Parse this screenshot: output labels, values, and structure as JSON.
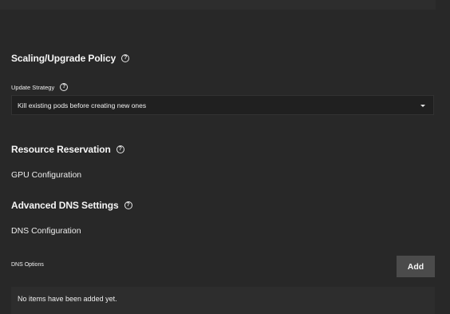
{
  "scaling": {
    "title": "Scaling/Upgrade Policy",
    "update_strategy_label": "Update Strategy",
    "update_strategy_value": "Kill existing pods before creating new ones"
  },
  "resources": {
    "title": "Resource Reservation",
    "gpu_label": "GPU Configuration"
  },
  "dns": {
    "title": "Advanced DNS Settings",
    "config_label": "DNS Configuration",
    "options_label": "DNS Options",
    "add_label": "Add",
    "empty_text": "No items have been added yet."
  },
  "icons": {
    "help": "?"
  }
}
